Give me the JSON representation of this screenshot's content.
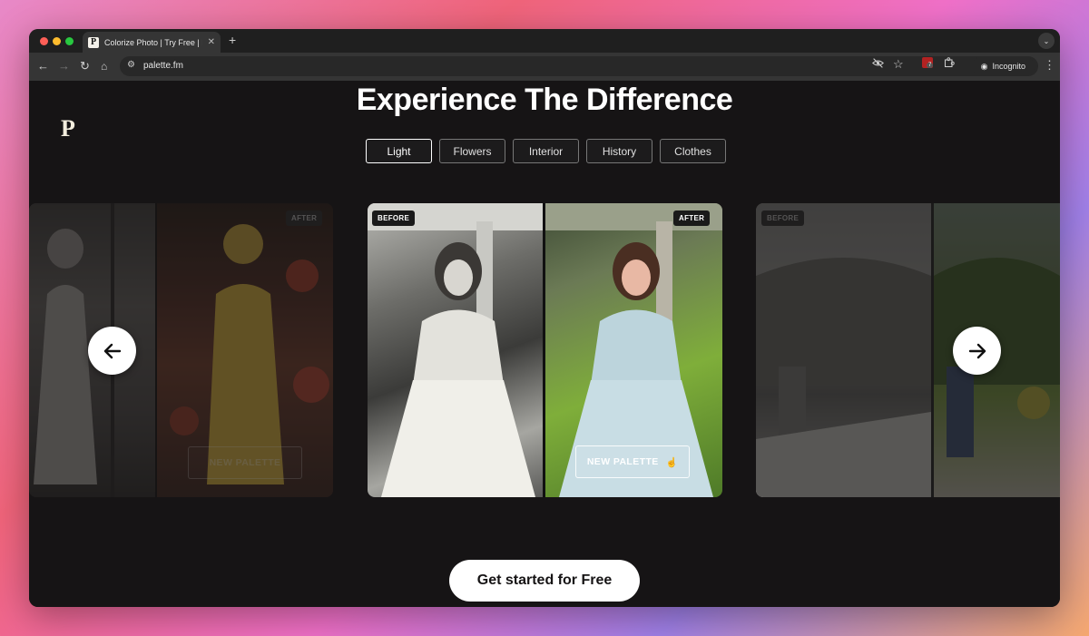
{
  "browser": {
    "tab_title": "Colorize Photo | Try Free | Re",
    "favicon_letter": "P",
    "url": "palette.fm",
    "incognito_label": "Incognito",
    "extension_badge": "7"
  },
  "page": {
    "logo": "P",
    "heading": "Experience The Difference",
    "filters": [
      "Light",
      "Flowers",
      "Interior",
      "History",
      "Clothes"
    ],
    "active_filter": "Light",
    "cards": {
      "left": {
        "after_tag": "AFTER",
        "button": "NEW PALETTE"
      },
      "center": {
        "before_tag": "BEFORE",
        "after_tag": "AFTER",
        "button": "NEW PALETTE"
      },
      "right": {
        "before_tag": "BEFORE"
      }
    },
    "cta": "Get started for Free"
  },
  "icons": [
    "back-arrow-icon",
    "forward-arrow-icon",
    "reload-icon",
    "home-icon",
    "tune-icon",
    "eye-off-icon",
    "star-icon",
    "puzzle-icon",
    "incognito-icon",
    "more-icon",
    "arrow-left-icon",
    "arrow-right-icon",
    "hand-pointer-icon"
  ]
}
